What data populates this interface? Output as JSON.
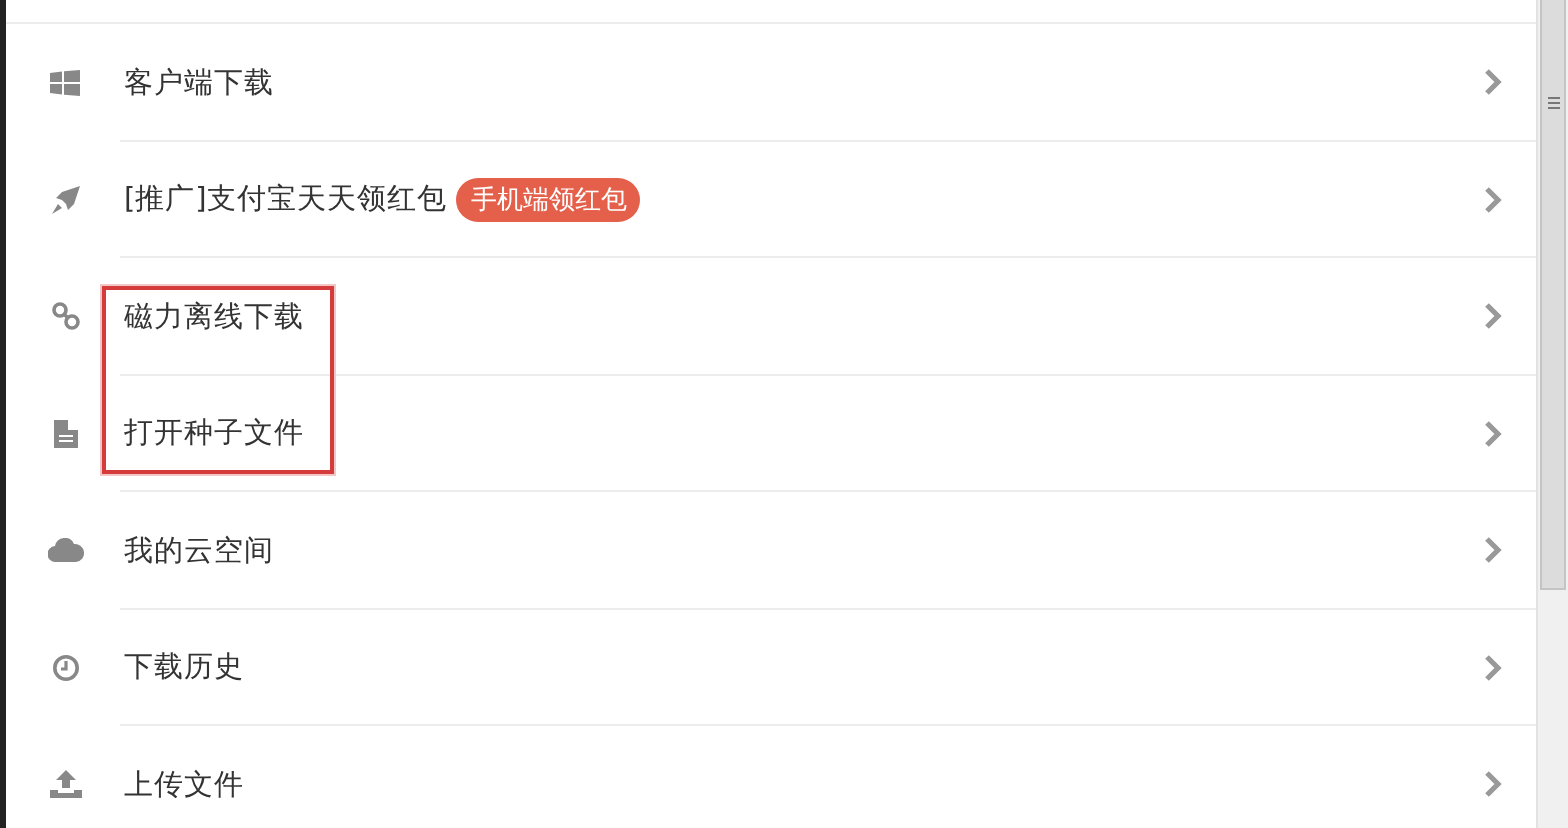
{
  "items": [
    {
      "label": "客户端下载",
      "highlighted": false
    },
    {
      "label": "[推广]支付宝天天领红包",
      "badge": "手机端领红包",
      "highlighted": false
    },
    {
      "label": "磁力离线下载",
      "highlighted": true
    },
    {
      "label": "打开种子文件",
      "highlighted": true
    },
    {
      "label": "我的云空间",
      "highlighted": false
    },
    {
      "label": "下载历史",
      "highlighted": false
    },
    {
      "label": "上传文件",
      "highlighted": false
    }
  ]
}
